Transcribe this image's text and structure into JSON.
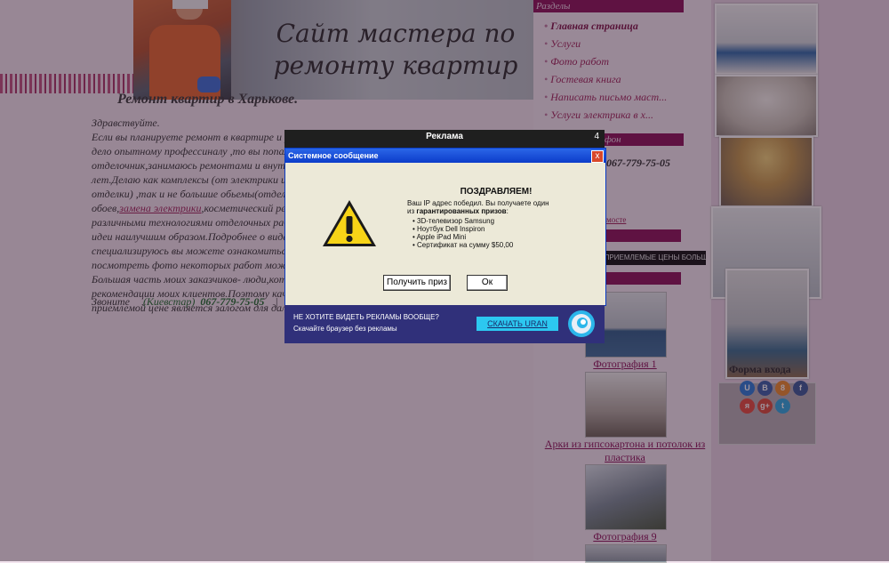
{
  "banner": {
    "title_line1": "Сайт мастера по",
    "title_line2": "ремонту квартир"
  },
  "page": {
    "heading": "Ремонт квартир в Харькове.",
    "greeting": "Здравствуйте.",
    "lines": [
      "Если вы планируете ремонт в квартире и р",
      "дело опытному профессиналу ,то вы попал",
      "отделочник,занимаюсь ремонтами и внутре",
      "лет.Делаю как комплексы (от электрики и ч",
      "отделки) ,так и не большие обьемы(отделк",
      "различными технологиями отделочных рабо",
      "идеи наилучшим образом.Подробнее о видах",
      "специализируюсь вы можете ознакомиться",
      "посмотреть фото некоторых работ можно",
      "Большая часть моих заказчиков- люди,кото",
      "рекомендации моих клиентов.Поэтому качес",
      "приемлемой цене является залогом для даль"
    ],
    "line6_pre": "обоев,",
    "line6_link": "замена электрики",
    "line6_post": ",косметический ремо",
    "contact_label": "Звоните",
    "contact_operator": "(Киевстар)",
    "contact_phone": "067-779-75-05",
    "contact_sep": "|"
  },
  "nav": {
    "header": "Разделы",
    "items": [
      {
        "label": "Главная страница"
      },
      {
        "label": "Услуги"
      },
      {
        "label": "Фото работ"
      },
      {
        "label": "Гостевая книга"
      },
      {
        "label": "Написать письмо маст..."
      },
      {
        "label": "Услуги электрика в х..."
      }
    ],
    "header2": "фон",
    "phone": "067-779-75-05",
    "small_link": "мосте",
    "promo": "Д,ПРИЕМЛЕМЫЕ ЦЕНЫ БОЛЬШОЙ"
  },
  "gallery": {
    "captions": [
      "Фотография 1",
      "Арки из гипсокартона и потолок из пластика",
      "Фотография 9"
    ]
  },
  "right": {
    "forma": "Форма входа",
    "share": [
      "U",
      "B",
      "8",
      "f",
      "я",
      "g+",
      "t"
    ]
  },
  "ad": {
    "header": "Реклама",
    "countdown": "4",
    "dialog_title": "Системное сообщение",
    "close": "x",
    "congrats": "ПОЗДРАВЛЯЕМ!",
    "msg1": "Ваш IP адрес победил. Вы получаете один",
    "msg2_pre": "из ",
    "msg2_bold": "гарантированных призов",
    "msg2_post": ":",
    "prizes": [
      "3D-телевизор Samsung",
      "Ноутбук Dell Inspiron",
      "Apple iPad Mini",
      "Сертификат на сумму $50,00"
    ],
    "btn_prize": "Получить приз",
    "btn_ok": "Ок",
    "bottom1": "НЕ ХОТИТЕ ВИДЕТЬ РЕКЛАМЫ ВООБЩЕ?",
    "bottom2": "Скачайте браузер без рекламы",
    "download": "СКАЧАТЬ URAN"
  },
  "colors": {
    "accent": "#8c1158",
    "dialog_blue": "#0c3cc9",
    "download_btn": "#2cc8f0"
  }
}
